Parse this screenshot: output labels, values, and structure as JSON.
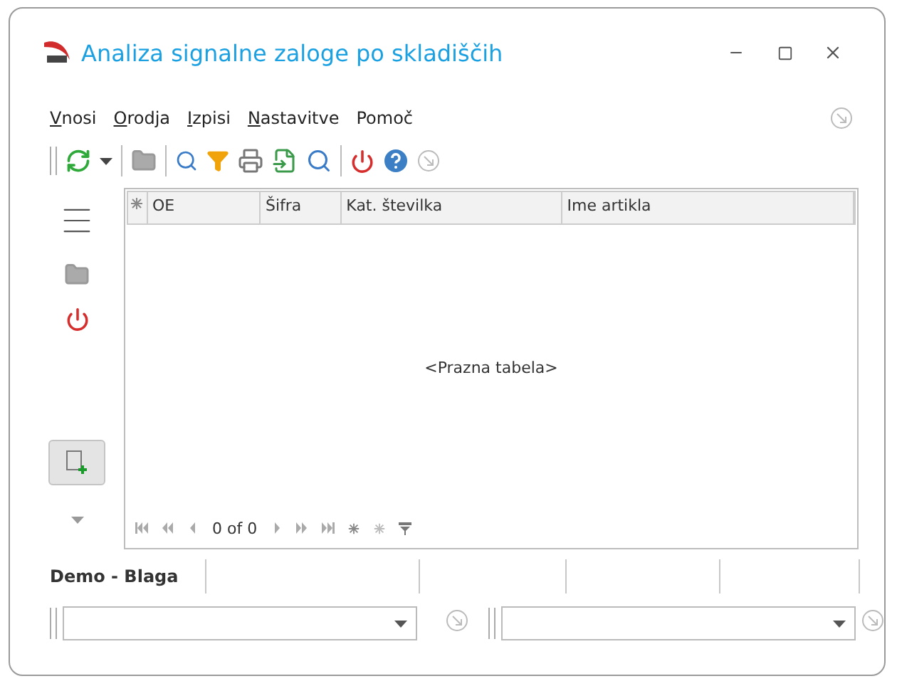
{
  "window": {
    "title": "Analiza signalne zaloge po skladiščih"
  },
  "menu": [
    {
      "label": "Vnosi",
      "underlined": true
    },
    {
      "label": "Orodja",
      "underlined": true
    },
    {
      "label": "Izpisi",
      "underlined": true
    },
    {
      "label": "Nastavitve",
      "underlined": true
    },
    {
      "label": "Pomoč",
      "underlined": false
    }
  ],
  "grid": {
    "columns": [
      "OE",
      "Šifra",
      "Kat. številka",
      "Ime artikla"
    ],
    "empty_text": "<Prazna tabela>",
    "pager": "0 of 0"
  },
  "status_bar": {
    "label": "Demo - Blaga"
  }
}
